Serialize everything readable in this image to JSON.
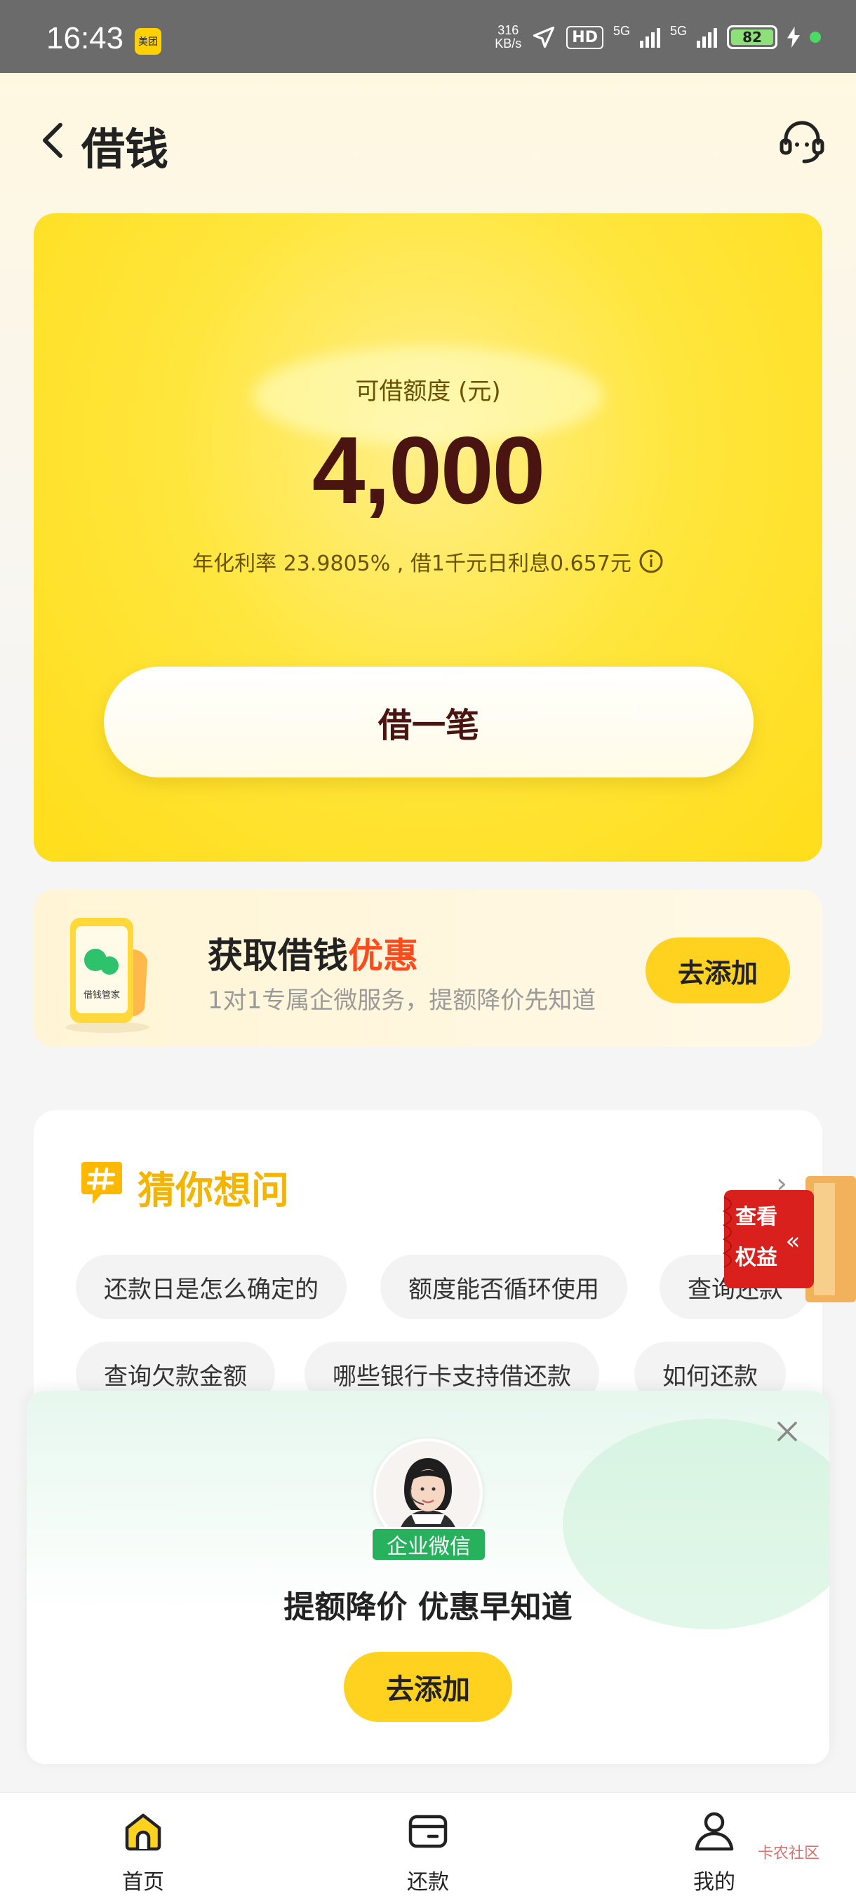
{
  "status_bar": {
    "time": "16:43",
    "app_badge": "美团",
    "net_speed_top": "316",
    "net_speed_bottom": "KB/s",
    "hd": "HD",
    "net1": "5G",
    "net2": "5G",
    "battery": "82"
  },
  "header": {
    "title": "借钱"
  },
  "loan_card": {
    "limit_label": "可借额度 (元)",
    "limit_amount": "4,000",
    "rate_text": "年化利率  23.9805% , 借1千元日利息0.657元",
    "borrow_label": "借一笔"
  },
  "promo": {
    "title_prefix": "获取借钱",
    "title_highlight": "优惠",
    "subtitle": "1对1专属企微服务，提额降价先知道",
    "button_label": "去添加",
    "phone_caption": "借钱管家"
  },
  "faq": {
    "title": "猜你想问",
    "chips": [
      "还款日是怎么确定的",
      "额度能否循环使用",
      "查询还款",
      "查询欠款金额",
      "哪些银行卡支持借还款",
      "如何还款"
    ]
  },
  "benefit_badge": {
    "label": "查看权益"
  },
  "popup": {
    "tag": "企业微信",
    "title": "提额降价 优惠早知道",
    "button_label": "去添加"
  },
  "bottom_nav": {
    "items": [
      {
        "label": "首页",
        "icon": "home-icon"
      },
      {
        "label": "还款",
        "icon": "wallet-icon"
      },
      {
        "label": "我的",
        "icon": "user-icon"
      }
    ]
  },
  "watermark": "卡农社区",
  "colors": {
    "accent": "#ffd21f",
    "dark_red": "#4a1410",
    "highlight": "#ff4a1c",
    "faq_title": "#f5b400",
    "wecom_green": "#27b15c"
  }
}
